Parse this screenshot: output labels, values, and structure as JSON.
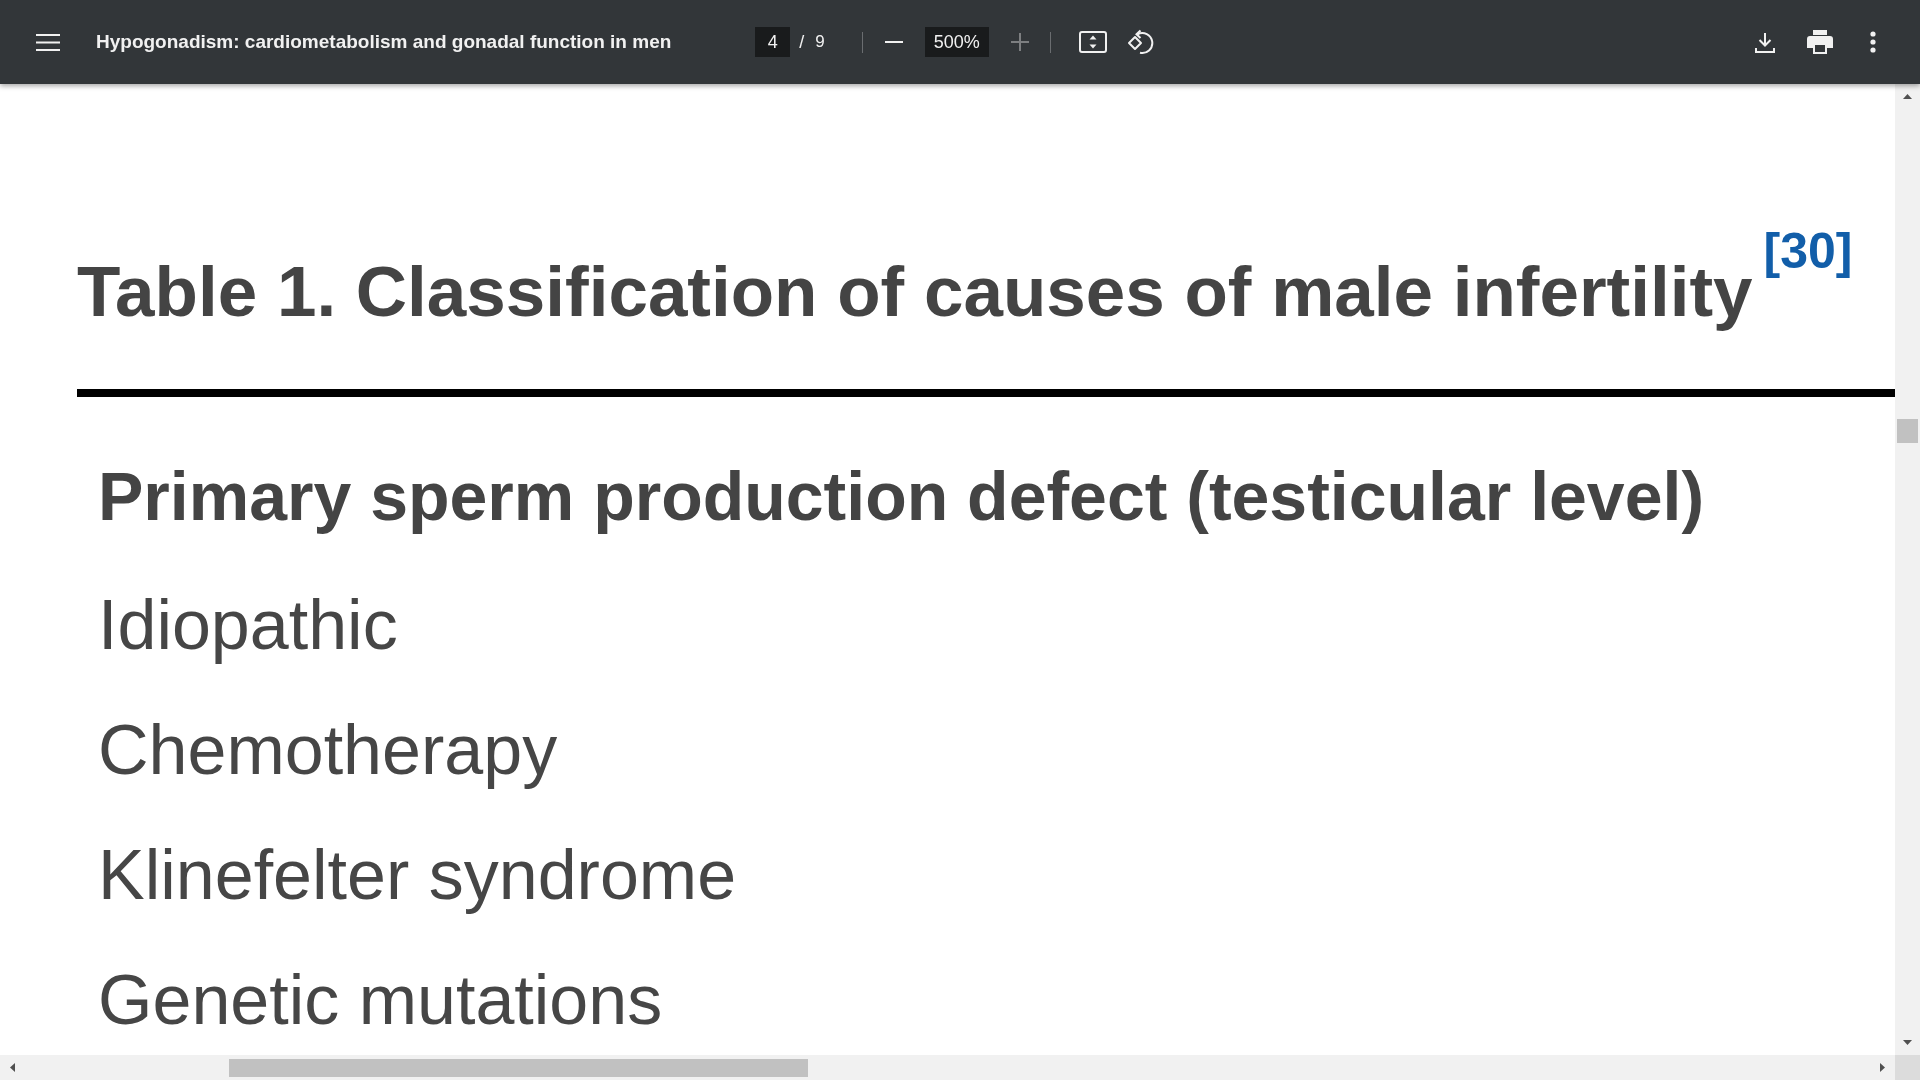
{
  "toolbar": {
    "title": "Hypogonadism: cardiometabolism and gonadal function in men",
    "page_number": "4",
    "page_separator": "/",
    "page_count": "9",
    "zoom_out": {
      "disabled": false
    },
    "zoom_level": "500%",
    "zoom_in": {
      "disabled": true
    }
  },
  "document": {
    "table_title": "Table 1. Classification of causes of male infertility",
    "reference": "[30]",
    "section_heading": "Primary sperm production defect (testicular level)",
    "items": [
      "Idiopathic",
      "Chemotherapy",
      "Klinefelter syndrome",
      "Genetic mutations"
    ]
  }
}
